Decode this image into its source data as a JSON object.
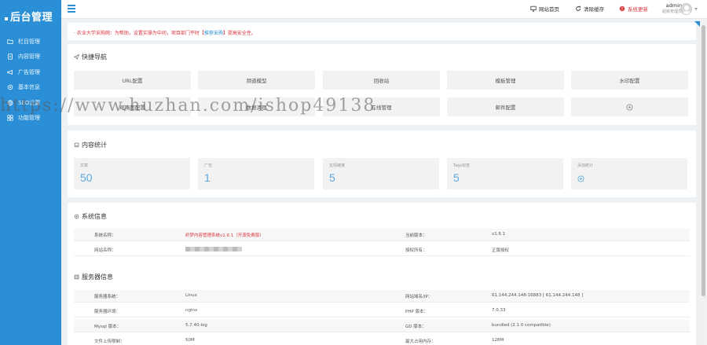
{
  "sidebar": {
    "logo": "后台管理",
    "items": [
      {
        "label": "栏目管理",
        "icon": "folder-icon"
      },
      {
        "label": "内容管理",
        "icon": "document-icon"
      },
      {
        "label": "广告管理",
        "icon": "megaphone-icon"
      },
      {
        "label": "基本信息",
        "icon": "gear-icon"
      },
      {
        "label": "SEO设置",
        "icon": "globe-icon"
      },
      {
        "label": "功能管理",
        "icon": "grid-icon"
      }
    ]
  },
  "topbar": {
    "site_home": "网站首页",
    "clear_cache": "清除缓存",
    "system_update": "系统更新",
    "admin_name": "admin",
    "admin_role": "超级管理员"
  },
  "notice": {
    "text_before": "· 农业大学采购网：为帮助，设置实操为中间，项目部门平时【",
    "link": "推荐采购",
    "text_after": "】提高安全性。"
  },
  "quick_nav": {
    "title": "快捷导航",
    "buttons": [
      "URL配置",
      "频道模型",
      "回收站",
      "模板管理",
      "水印配置",
      "缩略图配置",
      "数据清理",
      "在线管理",
      "邮件配置"
    ]
  },
  "stats": {
    "title": "内容统计",
    "items": [
      {
        "label": "文章",
        "value": "50"
      },
      {
        "label": "广告",
        "value": "1"
      },
      {
        "label": "友情链接",
        "value": "5"
      },
      {
        "label": "Tags标签",
        "value": "5"
      }
    ],
    "more_label": "添加统计"
  },
  "system_info": {
    "title": "系统信息",
    "rows": [
      {
        "k1": "系统名称：",
        "v1": "织梦内容管理系统v1.6.1（开源免费版）",
        "k2": "当前版本：",
        "v2": "v1.6.1"
      },
      {
        "k1": "网站名称：",
        "v1": "",
        "k2": "授权所有：",
        "v2": "正版授权"
      }
    ]
  },
  "server_info": {
    "title": "服务器信息",
    "rows": [
      {
        "k1": "服务器系统：",
        "v1": "Linux",
        "k2": "网站域名/IP：",
        "v2": "61.144.244.148:16883 [ 61.144.244.148 ]"
      },
      {
        "k1": "服务器环境：",
        "v1": "nginx",
        "k2": "PHP 版本：",
        "v2": "7.0.33"
      },
      {
        "k1": "Mysql 版本：",
        "v1": "5.7.40-log",
        "k2": "GD 版本：",
        "v2": "bundled (2.1.0 compatible)"
      },
      {
        "k1": "文件上传限制：",
        "v1": "50M",
        "k2": "最大占用内存：",
        "v2": "128M"
      }
    ]
  },
  "watermark": "https://www.huzhan.com/ishop49138",
  "colors": {
    "primary": "#2a8fd6",
    "danger": "#d9363e",
    "stat_value": "#5aa7e0"
  }
}
